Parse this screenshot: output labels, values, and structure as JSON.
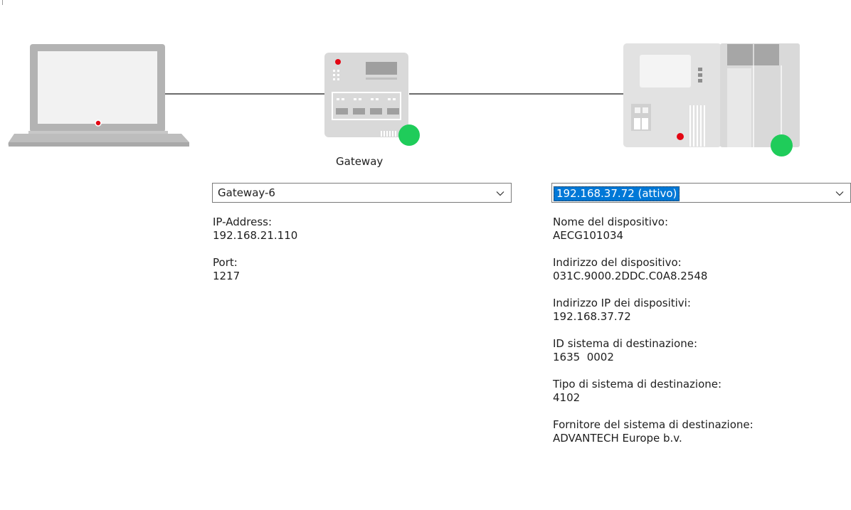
{
  "gateway": {
    "caption": "Gateway",
    "status_color": "#1fcc5a",
    "accent_color": "#e30613"
  },
  "device": {
    "status_color": "#1fcc5a"
  },
  "gateway_select": {
    "value": "Gateway-6"
  },
  "gateway_info": [
    {
      "label": "IP-Address:",
      "value": "192.168.21.110"
    },
    {
      "label": "Port:",
      "value": "1217"
    }
  ],
  "device_select": {
    "value": "192.168.37.72 (attivo)"
  },
  "device_info": [
    {
      "label": "Nome del dispositivo:",
      "value": "AECG101034"
    },
    {
      "label": "Indirizzo del dispositivo:",
      "value": "031C.9000.2DDC.C0A8.2548"
    },
    {
      "label": "Indirizzo IP dei dispositivi:",
      "value": "192.168.37.72"
    },
    {
      "label": "ID sistema di destinazione:",
      "value": "1635  0002"
    },
    {
      "label": "Tipo di sistema di destinazione:",
      "value": "4102"
    },
    {
      "label": "Fornitore del sistema di destinazione:",
      "value": "ADVANTECH Europe b.v."
    }
  ]
}
